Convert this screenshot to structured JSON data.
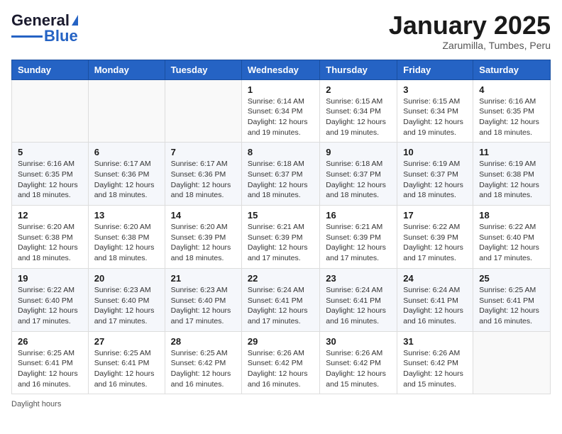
{
  "logo": {
    "line1": "General",
    "line2": "Blue"
  },
  "title": "January 2025",
  "subtitle": "Zarumilla, Tumbes, Peru",
  "days_of_week": [
    "Sunday",
    "Monday",
    "Tuesday",
    "Wednesday",
    "Thursday",
    "Friday",
    "Saturday"
  ],
  "weeks": [
    [
      {
        "num": "",
        "sunrise": "",
        "sunset": "",
        "daylight": ""
      },
      {
        "num": "",
        "sunrise": "",
        "sunset": "",
        "daylight": ""
      },
      {
        "num": "",
        "sunrise": "",
        "sunset": "",
        "daylight": ""
      },
      {
        "num": "1",
        "sunrise": "Sunrise: 6:14 AM",
        "sunset": "Sunset: 6:34 PM",
        "daylight": "Daylight: 12 hours and 19 minutes."
      },
      {
        "num": "2",
        "sunrise": "Sunrise: 6:15 AM",
        "sunset": "Sunset: 6:34 PM",
        "daylight": "Daylight: 12 hours and 19 minutes."
      },
      {
        "num": "3",
        "sunrise": "Sunrise: 6:15 AM",
        "sunset": "Sunset: 6:34 PM",
        "daylight": "Daylight: 12 hours and 19 minutes."
      },
      {
        "num": "4",
        "sunrise": "Sunrise: 6:16 AM",
        "sunset": "Sunset: 6:35 PM",
        "daylight": "Daylight: 12 hours and 18 minutes."
      }
    ],
    [
      {
        "num": "5",
        "sunrise": "Sunrise: 6:16 AM",
        "sunset": "Sunset: 6:35 PM",
        "daylight": "Daylight: 12 hours and 18 minutes."
      },
      {
        "num": "6",
        "sunrise": "Sunrise: 6:17 AM",
        "sunset": "Sunset: 6:36 PM",
        "daylight": "Daylight: 12 hours and 18 minutes."
      },
      {
        "num": "7",
        "sunrise": "Sunrise: 6:17 AM",
        "sunset": "Sunset: 6:36 PM",
        "daylight": "Daylight: 12 hours and 18 minutes."
      },
      {
        "num": "8",
        "sunrise": "Sunrise: 6:18 AM",
        "sunset": "Sunset: 6:37 PM",
        "daylight": "Daylight: 12 hours and 18 minutes."
      },
      {
        "num": "9",
        "sunrise": "Sunrise: 6:18 AM",
        "sunset": "Sunset: 6:37 PM",
        "daylight": "Daylight: 12 hours and 18 minutes."
      },
      {
        "num": "10",
        "sunrise": "Sunrise: 6:19 AM",
        "sunset": "Sunset: 6:37 PM",
        "daylight": "Daylight: 12 hours and 18 minutes."
      },
      {
        "num": "11",
        "sunrise": "Sunrise: 6:19 AM",
        "sunset": "Sunset: 6:38 PM",
        "daylight": "Daylight: 12 hours and 18 minutes."
      }
    ],
    [
      {
        "num": "12",
        "sunrise": "Sunrise: 6:20 AM",
        "sunset": "Sunset: 6:38 PM",
        "daylight": "Daylight: 12 hours and 18 minutes."
      },
      {
        "num": "13",
        "sunrise": "Sunrise: 6:20 AM",
        "sunset": "Sunset: 6:38 PM",
        "daylight": "Daylight: 12 hours and 18 minutes."
      },
      {
        "num": "14",
        "sunrise": "Sunrise: 6:20 AM",
        "sunset": "Sunset: 6:39 PM",
        "daylight": "Daylight: 12 hours and 18 minutes."
      },
      {
        "num": "15",
        "sunrise": "Sunrise: 6:21 AM",
        "sunset": "Sunset: 6:39 PM",
        "daylight": "Daylight: 12 hours and 17 minutes."
      },
      {
        "num": "16",
        "sunrise": "Sunrise: 6:21 AM",
        "sunset": "Sunset: 6:39 PM",
        "daylight": "Daylight: 12 hours and 17 minutes."
      },
      {
        "num": "17",
        "sunrise": "Sunrise: 6:22 AM",
        "sunset": "Sunset: 6:39 PM",
        "daylight": "Daylight: 12 hours and 17 minutes."
      },
      {
        "num": "18",
        "sunrise": "Sunrise: 6:22 AM",
        "sunset": "Sunset: 6:40 PM",
        "daylight": "Daylight: 12 hours and 17 minutes."
      }
    ],
    [
      {
        "num": "19",
        "sunrise": "Sunrise: 6:22 AM",
        "sunset": "Sunset: 6:40 PM",
        "daylight": "Daylight: 12 hours and 17 minutes."
      },
      {
        "num": "20",
        "sunrise": "Sunrise: 6:23 AM",
        "sunset": "Sunset: 6:40 PM",
        "daylight": "Daylight: 12 hours and 17 minutes."
      },
      {
        "num": "21",
        "sunrise": "Sunrise: 6:23 AM",
        "sunset": "Sunset: 6:40 PM",
        "daylight": "Daylight: 12 hours and 17 minutes."
      },
      {
        "num": "22",
        "sunrise": "Sunrise: 6:24 AM",
        "sunset": "Sunset: 6:41 PM",
        "daylight": "Daylight: 12 hours and 17 minutes."
      },
      {
        "num": "23",
        "sunrise": "Sunrise: 6:24 AM",
        "sunset": "Sunset: 6:41 PM",
        "daylight": "Daylight: 12 hours and 16 minutes."
      },
      {
        "num": "24",
        "sunrise": "Sunrise: 6:24 AM",
        "sunset": "Sunset: 6:41 PM",
        "daylight": "Daylight: 12 hours and 16 minutes."
      },
      {
        "num": "25",
        "sunrise": "Sunrise: 6:25 AM",
        "sunset": "Sunset: 6:41 PM",
        "daylight": "Daylight: 12 hours and 16 minutes."
      }
    ],
    [
      {
        "num": "26",
        "sunrise": "Sunrise: 6:25 AM",
        "sunset": "Sunset: 6:41 PM",
        "daylight": "Daylight: 12 hours and 16 minutes."
      },
      {
        "num": "27",
        "sunrise": "Sunrise: 6:25 AM",
        "sunset": "Sunset: 6:41 PM",
        "daylight": "Daylight: 12 hours and 16 minutes."
      },
      {
        "num": "28",
        "sunrise": "Sunrise: 6:25 AM",
        "sunset": "Sunset: 6:42 PM",
        "daylight": "Daylight: 12 hours and 16 minutes."
      },
      {
        "num": "29",
        "sunrise": "Sunrise: 6:26 AM",
        "sunset": "Sunset: 6:42 PM",
        "daylight": "Daylight: 12 hours and 16 minutes."
      },
      {
        "num": "30",
        "sunrise": "Sunrise: 6:26 AM",
        "sunset": "Sunset: 6:42 PM",
        "daylight": "Daylight: 12 hours and 15 minutes."
      },
      {
        "num": "31",
        "sunrise": "Sunrise: 6:26 AM",
        "sunset": "Sunset: 6:42 PM",
        "daylight": "Daylight: 12 hours and 15 minutes."
      },
      {
        "num": "",
        "sunrise": "",
        "sunset": "",
        "daylight": ""
      }
    ]
  ],
  "footer": "Daylight hours"
}
